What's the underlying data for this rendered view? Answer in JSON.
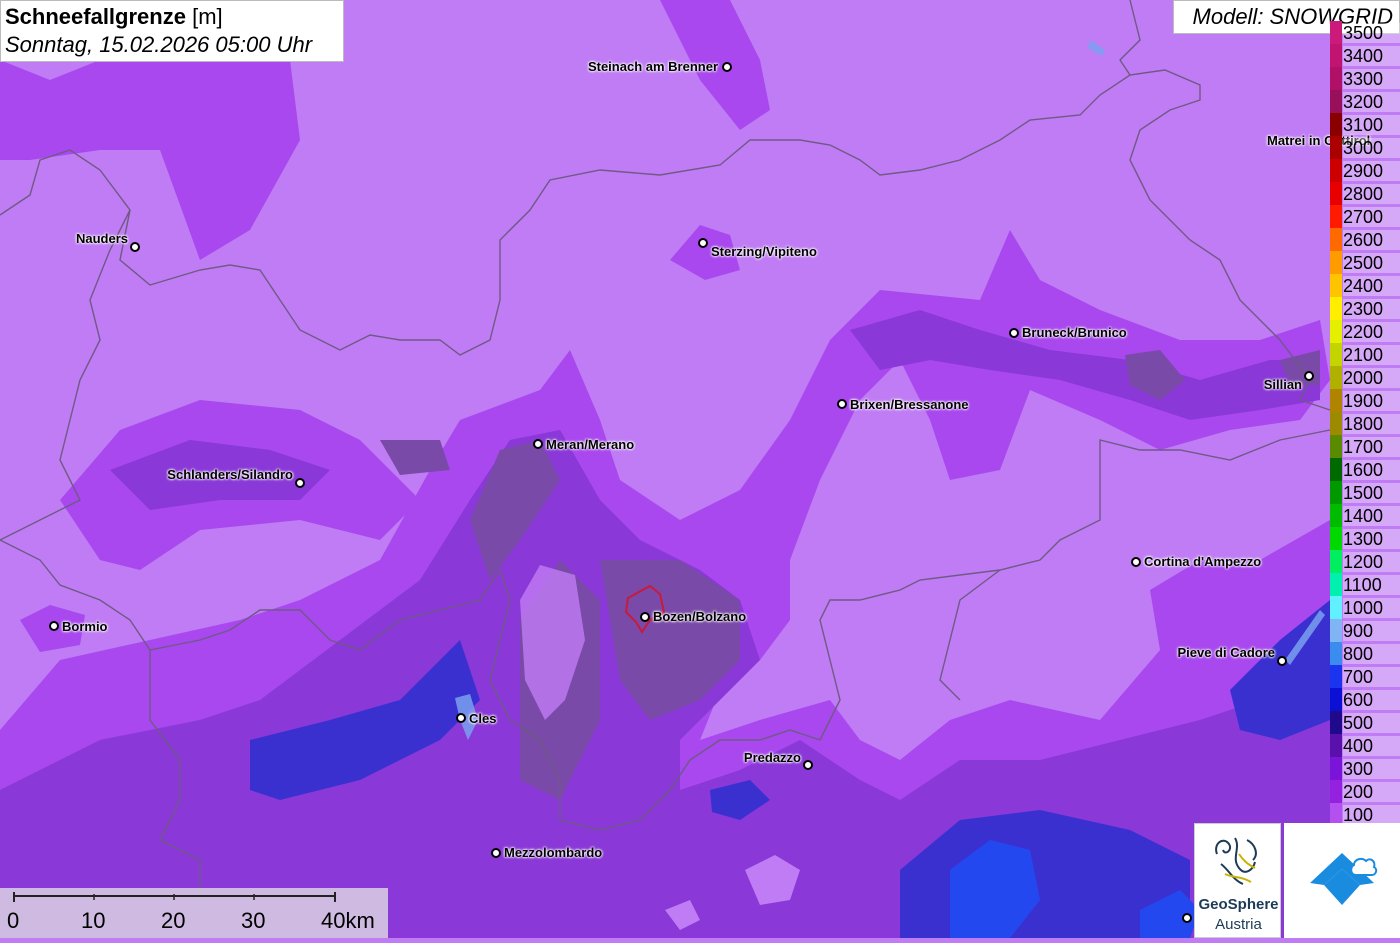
{
  "header": {
    "title_bold": "Schneefallgrenze",
    "title_unit": "[m]",
    "subtitle": "Sonntag, 15.02.2026 05:00 Uhr",
    "model": "Modell: SNOWGRID"
  },
  "colors": {
    "land_light": "#c07cf4",
    "band_mid": "#a848ee",
    "band_dark": "#8a38d8",
    "valley_grey": "#7a4aa8",
    "valley_purple": "#9a6ad8",
    "blue_low": "#3a30d0",
    "bright_blue": "#2448f0",
    "border_line": "#6e5a84"
  },
  "cities": [
    {
      "name": "Steinach am Brenner",
      "label_side": "left"
    },
    {
      "name": "Matrei in Osttirol",
      "label_side": "left"
    },
    {
      "name": "Nauders",
      "label_side": "left"
    },
    {
      "name": "Sterzing/Vipiteno",
      "label_side": "right"
    },
    {
      "name": "Bruneck/Brunico",
      "label_side": "right"
    },
    {
      "name": "Sillian",
      "label_side": "left"
    },
    {
      "name": "Brixen/Bressanone",
      "label_side": "right"
    },
    {
      "name": "Meran/Merano",
      "label_side": "right"
    },
    {
      "name": "Schlanders/Silandro",
      "label_side": "left"
    },
    {
      "name": "Cortina d'Ampezzo",
      "label_side": "right"
    },
    {
      "name": "Bormio",
      "label_side": "right"
    },
    {
      "name": "Bozen/Bolzano",
      "label_side": "right"
    },
    {
      "name": "Pieve di Cadore",
      "label_side": "left"
    },
    {
      "name": "Cles",
      "label_side": "right"
    },
    {
      "name": "Predazzo",
      "label_side": "left"
    },
    {
      "name": "Mezzolombardo",
      "label_side": "right"
    }
  ],
  "legend": [
    {
      "label": "3500",
      "color": "#cc1a7a"
    },
    {
      "label": "3400",
      "color": "#c01470"
    },
    {
      "label": "3300",
      "color": "#b01066"
    },
    {
      "label": "3200",
      "color": "#98105a"
    },
    {
      "label": "3100",
      "color": "#8a0000"
    },
    {
      "label": "3000",
      "color": "#aa0000"
    },
    {
      "label": "2900",
      "color": "#cc0000"
    },
    {
      "label": "2800",
      "color": "#e80000"
    },
    {
      "label": "2700",
      "color": "#ff1a00"
    },
    {
      "label": "2600",
      "color": "#ff6a00"
    },
    {
      "label": "2500",
      "color": "#ff9a00"
    },
    {
      "label": "2400",
      "color": "#ffc400"
    },
    {
      "label": "2300",
      "color": "#ffee00"
    },
    {
      "label": "2200",
      "color": "#e4f000"
    },
    {
      "label": "2100",
      "color": "#c4d400"
    },
    {
      "label": "2000",
      "color": "#b0b000"
    },
    {
      "label": "1900",
      "color": "#b08400"
    },
    {
      "label": "1800",
      "color": "#9c8a00"
    },
    {
      "label": "1700",
      "color": "#5a8a00"
    },
    {
      "label": "1600",
      "color": "#006a00"
    },
    {
      "label": "1500",
      "color": "#009a00"
    },
    {
      "label": "1400",
      "color": "#00bb00"
    },
    {
      "label": "1300",
      "color": "#00d800"
    },
    {
      "label": "1200",
      "color": "#00ee60"
    },
    {
      "label": "1100",
      "color": "#00f0b0"
    },
    {
      "label": "1000",
      "color": "#60f0ff"
    },
    {
      "label": "900",
      "color": "#80b4f4"
    },
    {
      "label": "800",
      "color": "#3c8cf0"
    },
    {
      "label": "700",
      "color": "#1a34f0"
    },
    {
      "label": "600",
      "color": "#0a10d4"
    },
    {
      "label": "500",
      "color": "#200a8c"
    },
    {
      "label": "400",
      "color": "#5a10aa"
    },
    {
      "label": "300",
      "color": "#7a14d8"
    },
    {
      "label": "200",
      "color": "#9420e0"
    },
    {
      "label": "100",
      "color": "#b450f0"
    }
  ],
  "scalebar": {
    "labels": [
      "0",
      "10",
      "20",
      "30",
      "40km"
    ]
  },
  "logos": {
    "geosphere_line1": "GeoSphere",
    "geosphere_line2": "Austria"
  }
}
